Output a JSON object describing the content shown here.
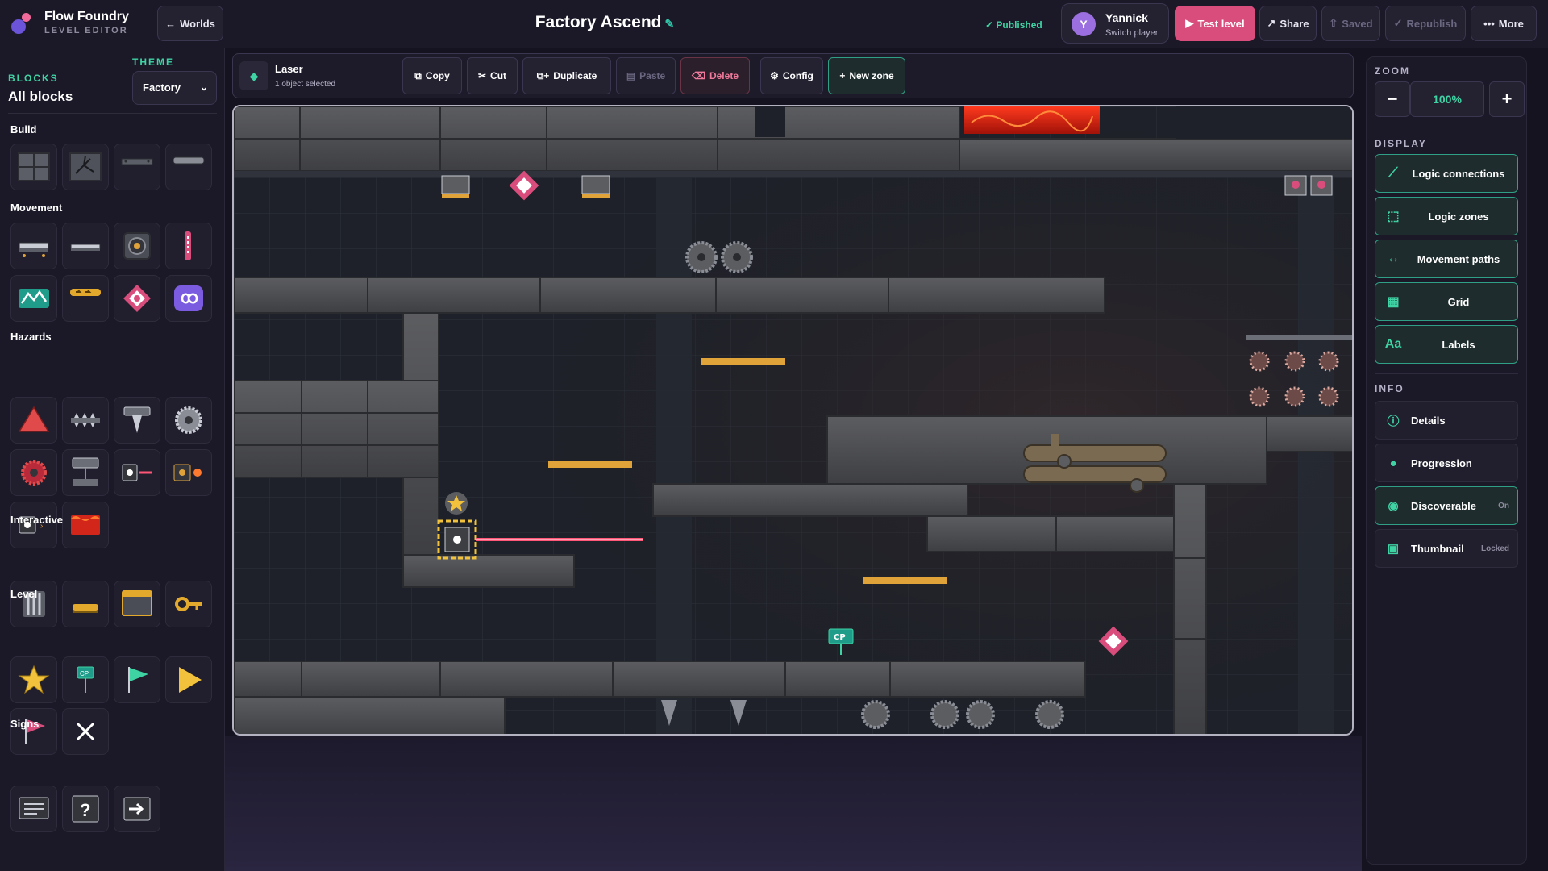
{
  "app": {
    "name": "Flow Foundry",
    "subtitle": "LEVEL EDITOR"
  },
  "header": {
    "worlds_label": "Worlds",
    "level_title": "Factory Ascend",
    "status": "Published",
    "player": {
      "initial": "Y",
      "name": "Yannick",
      "action": "Switch player"
    },
    "buttons": {
      "test": "Test level",
      "share": "Share",
      "saved": "Saved",
      "republish": "Republish",
      "more": "More"
    }
  },
  "sidebar": {
    "blocks_label": "BLOCKS",
    "all_blocks": "All blocks",
    "theme_label": "THEME",
    "theme_value": "Factory",
    "categories": [
      "Build",
      "Movement",
      "Hazards",
      "Interactive",
      "Level",
      "Signs"
    ]
  },
  "toolbar": {
    "selected_name": "Laser",
    "selected_count": "1 object selected",
    "buttons": [
      "Copy",
      "Cut",
      "Duplicate",
      "Paste",
      "Delete",
      "Config",
      "New zone"
    ]
  },
  "canvas": {
    "checkpoint_label": "CP"
  },
  "right_panel": {
    "zoom_label": "ZOOM",
    "zoom_value": "100%",
    "display_label": "DISPLAY",
    "display_items": [
      "Logic connections",
      "Logic zones",
      "Movement paths",
      "Grid",
      "Labels"
    ],
    "info_label": "INFO",
    "info_items": [
      {
        "label": "Details",
        "tag": ""
      },
      {
        "label": "Progression",
        "tag": ""
      },
      {
        "label": "Discoverable",
        "tag": "On"
      },
      {
        "label": "Thumbnail",
        "tag": "Locked"
      }
    ]
  },
  "colors": {
    "accent": "#3fd3a4",
    "danger": "#d94d7d",
    "laser": "#ff5577",
    "lava": "#d2261a"
  }
}
